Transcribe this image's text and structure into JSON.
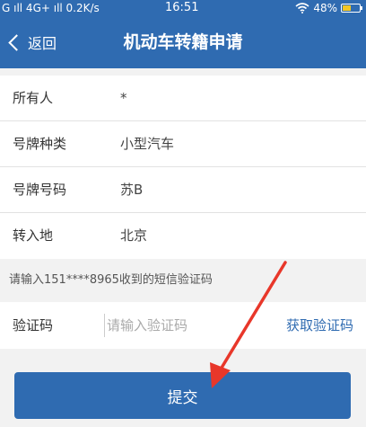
{
  "status_bar": {
    "left": "G ıll 4G+ ıll  0.2K/s",
    "time": "16:51",
    "battery": "48%",
    "battery_level": 0.48,
    "battery_color": "#f3c623"
  },
  "nav": {
    "back_label": "返回",
    "title": "机动车转籍申请"
  },
  "info": {
    "rows": [
      {
        "label": "所有人",
        "value": "*"
      },
      {
        "label": "号牌种类",
        "value": "小型汽车"
      },
      {
        "label": "号牌号码",
        "value": "苏B"
      },
      {
        "label": "转入地",
        "value": "北京"
      }
    ]
  },
  "sms_hint": "请输入151****8965收到的短信验证码",
  "verify": {
    "label": "验证码",
    "placeholder": "请输入验证码",
    "value": "",
    "get_code_label": "获取验证码"
  },
  "submit_label": "提交",
  "colors": {
    "primary": "#2f6bb1",
    "annotation_arrow": "#e8372a"
  },
  "icons": {
    "back": "chevron-left-icon",
    "wifi": "wifi-icon",
    "battery": "battery-icon",
    "annotation": "red-arrow-annotation"
  }
}
